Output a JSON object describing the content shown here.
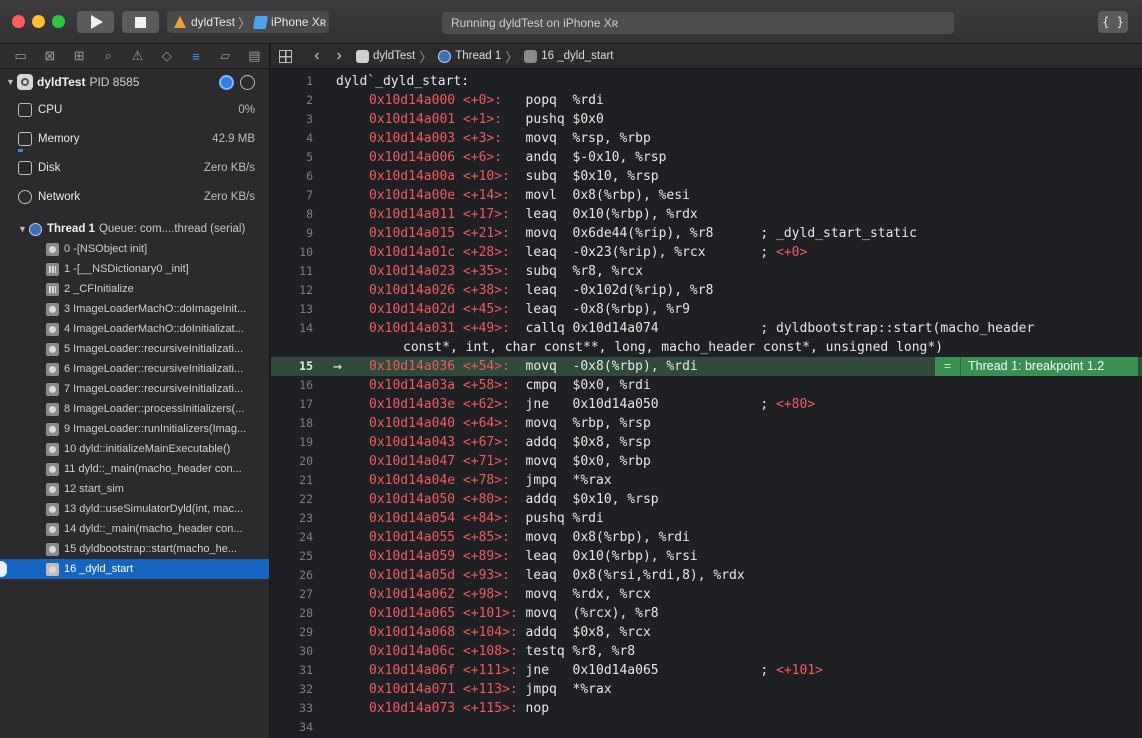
{
  "toolbar": {
    "scheme_target": "dyldTest",
    "scheme_device": "iPhone Xʀ",
    "activity_status": "Running dyldTest on iPhone Xʀ",
    "library_label": "{ }"
  },
  "navigator": {
    "process": {
      "name": "dyldTest",
      "pid": "PID 8585"
    },
    "gauges": [
      {
        "name": "CPU",
        "value": "0%",
        "fill": 0.0
      },
      {
        "name": "Memory",
        "value": "42.9 MB",
        "fill": 0.02
      },
      {
        "name": "Disk",
        "value": "Zero KB/s",
        "fill": 0.0
      },
      {
        "name": "Network",
        "value": "Zero KB/s",
        "fill": 0.0
      }
    ],
    "thread": {
      "name": "Thread 1",
      "queue": "Queue: com....thread (serial)"
    },
    "frames": [
      "0 -[NSObject init]",
      "1 -[__NSDictionary0 _init]",
      "2 _CFInitialize",
      "3 ImageLoaderMachO::doImageInit...",
      "4 ImageLoaderMachO::doInitializat...",
      "5 ImageLoader::recursiveInitializati...",
      "6 ImageLoader::recursiveInitializati...",
      "7 ImageLoader::recursiveInitializati...",
      "8 ImageLoader::processInitializers(...",
      "9 ImageLoader::runInitializers(Imag...",
      "10 dyld::initializeMainExecutable()",
      "11 dyld::_main(macho_header con...",
      "12 start_sim",
      "13 dyld::useSimulatorDyld(int, mac...",
      "14 dyld::_main(macho_header con...",
      "15 dyldbootstrap::start(macho_he...",
      "16 _dyld_start"
    ],
    "selected_frame": 16
  },
  "jumpbar": {
    "project": "dyldTest",
    "thread": "Thread 1",
    "frame": "16 _dyld_start"
  },
  "editor": {
    "header": "dyld`_dyld_start:",
    "breakpoint_label": "Thread 1: breakpoint 1.2",
    "current_line": 15,
    "lines": [
      {
        "n": 1,
        "addr": "",
        "off": "",
        "ins": "",
        "ops": "",
        "cmt": "",
        "cref": ""
      },
      {
        "n": 2,
        "addr": "0x10d14a000",
        "off": "<+0>:",
        "ins": "popq",
        "ops": "%rdi",
        "cmt": "",
        "cref": ""
      },
      {
        "n": 3,
        "addr": "0x10d14a001",
        "off": "<+1>:",
        "ins": "pushq",
        "ops": "$0x0",
        "cmt": "",
        "cref": ""
      },
      {
        "n": 4,
        "addr": "0x10d14a003",
        "off": "<+3>:",
        "ins": "movq",
        "ops": "%rsp, %rbp",
        "cmt": "",
        "cref": ""
      },
      {
        "n": 5,
        "addr": "0x10d14a006",
        "off": "<+6>:",
        "ins": "andq",
        "ops": "$-0x10, %rsp",
        "cmt": "",
        "cref": ""
      },
      {
        "n": 6,
        "addr": "0x10d14a00a",
        "off": "<+10>:",
        "ins": "subq",
        "ops": "$0x10, %rsp",
        "cmt": "",
        "cref": ""
      },
      {
        "n": 7,
        "addr": "0x10d14a00e",
        "off": "<+14>:",
        "ins": "movl",
        "ops": "0x8(%rbp), %esi",
        "cmt": "",
        "cref": ""
      },
      {
        "n": 8,
        "addr": "0x10d14a011",
        "off": "<+17>:",
        "ins": "leaq",
        "ops": "0x10(%rbp), %rdx",
        "cmt": "",
        "cref": ""
      },
      {
        "n": 9,
        "addr": "0x10d14a015",
        "off": "<+21>:",
        "ins": "movq",
        "ops": "0x6de44(%rip), %r8",
        "cmt": "; _dyld_start_static",
        "cref": ""
      },
      {
        "n": 10,
        "addr": "0x10d14a01c",
        "off": "<+28>:",
        "ins": "leaq",
        "ops": "-0x23(%rip), %rcx",
        "cmt": "; ",
        "cref": "<+0>"
      },
      {
        "n": 11,
        "addr": "0x10d14a023",
        "off": "<+35>:",
        "ins": "subq",
        "ops": "%r8, %rcx",
        "cmt": "",
        "cref": ""
      },
      {
        "n": 12,
        "addr": "0x10d14a026",
        "off": "<+38>:",
        "ins": "leaq",
        "ops": "-0x102d(%rip), %r8",
        "cmt": "",
        "cref": ""
      },
      {
        "n": 13,
        "addr": "0x10d14a02d",
        "off": "<+45>:",
        "ins": "leaq",
        "ops": "-0x8(%rbp), %r9",
        "cmt": "",
        "cref": ""
      },
      {
        "n": 14,
        "addr": "0x10d14a031",
        "off": "<+49>:",
        "ins": "callq",
        "ops": "0x10d14a074",
        "cmt": "; dyldbootstrap::start(macho_header",
        "cref": ""
      },
      {
        "n": 0,
        "addr": "",
        "off": "",
        "ins": "",
        "ops": "",
        "cmt": "",
        "cref": "",
        "wrap": "const*, int, char const**, long, macho_header const*, unsigned long*)"
      },
      {
        "n": 15,
        "addr": "0x10d14a036",
        "off": "<+54>:",
        "ins": "movq",
        "ops": "-0x8(%rbp), %rdi",
        "cmt": "",
        "cref": ""
      },
      {
        "n": 16,
        "addr": "0x10d14a03a",
        "off": "<+58>:",
        "ins": "cmpq",
        "ops": "$0x0, %rdi",
        "cmt": "",
        "cref": ""
      },
      {
        "n": 17,
        "addr": "0x10d14a03e",
        "off": "<+62>:",
        "ins": "jne",
        "ops": "0x10d14a050",
        "cmt": "; ",
        "cref": "<+80>"
      },
      {
        "n": 18,
        "addr": "0x10d14a040",
        "off": "<+64>:",
        "ins": "movq",
        "ops": "%rbp, %rsp",
        "cmt": "",
        "cref": ""
      },
      {
        "n": 19,
        "addr": "0x10d14a043",
        "off": "<+67>:",
        "ins": "addq",
        "ops": "$0x8, %rsp",
        "cmt": "",
        "cref": ""
      },
      {
        "n": 20,
        "addr": "0x10d14a047",
        "off": "<+71>:",
        "ins": "movq",
        "ops": "$0x0, %rbp",
        "cmt": "",
        "cref": ""
      },
      {
        "n": 21,
        "addr": "0x10d14a04e",
        "off": "<+78>:",
        "ins": "jmpq",
        "ops": "*%rax",
        "cmt": "",
        "cref": ""
      },
      {
        "n": 22,
        "addr": "0x10d14a050",
        "off": "<+80>:",
        "ins": "addq",
        "ops": "$0x10, %rsp",
        "cmt": "",
        "cref": ""
      },
      {
        "n": 23,
        "addr": "0x10d14a054",
        "off": "<+84>:",
        "ins": "pushq",
        "ops": "%rdi",
        "cmt": "",
        "cref": ""
      },
      {
        "n": 24,
        "addr": "0x10d14a055",
        "off": "<+85>:",
        "ins": "movq",
        "ops": "0x8(%rbp), %rdi",
        "cmt": "",
        "cref": ""
      },
      {
        "n": 25,
        "addr": "0x10d14a059",
        "off": "<+89>:",
        "ins": "leaq",
        "ops": "0x10(%rbp), %rsi",
        "cmt": "",
        "cref": ""
      },
      {
        "n": 26,
        "addr": "0x10d14a05d",
        "off": "<+93>:",
        "ins": "leaq",
        "ops": "0x8(%rsi,%rdi,8), %rdx",
        "cmt": "",
        "cref": ""
      },
      {
        "n": 27,
        "addr": "0x10d14a062",
        "off": "<+98>:",
        "ins": "movq",
        "ops": "%rdx, %rcx",
        "cmt": "",
        "cref": ""
      },
      {
        "n": 28,
        "addr": "0x10d14a065",
        "off": "<+101>:",
        "ins": "movq",
        "ops": "(%rcx), %r8",
        "cmt": "",
        "cref": ""
      },
      {
        "n": 29,
        "addr": "0x10d14a068",
        "off": "<+104>:",
        "ins": "addq",
        "ops": "$0x8, %rcx",
        "cmt": "",
        "cref": ""
      },
      {
        "n": 30,
        "addr": "0x10d14a06c",
        "off": "<+108>:",
        "ins": "testq",
        "ops": "%r8, %r8",
        "cmt": "",
        "cref": ""
      },
      {
        "n": 31,
        "addr": "0x10d14a06f",
        "off": "<+111>:",
        "ins": "jne",
        "ops": "0x10d14a065",
        "cmt": "; ",
        "cref": "<+101>"
      },
      {
        "n": 32,
        "addr": "0x10d14a071",
        "off": "<+113>:",
        "ins": "jmpq",
        "ops": "*%rax",
        "cmt": "",
        "cref": ""
      },
      {
        "n": 33,
        "addr": "0x10d14a073",
        "off": "<+115>:",
        "ins": "nop",
        "ops": "",
        "cmt": "",
        "cref": ""
      },
      {
        "n": 34,
        "addr": "",
        "off": "",
        "ins": "",
        "ops": "",
        "cmt": "",
        "cref": ""
      }
    ]
  },
  "colors": {
    "selection": "#1565c0",
    "breakpoint_line": "#2f4a3a",
    "breakpoint_badge": "#3c8f53",
    "address": "#ef5a60"
  }
}
